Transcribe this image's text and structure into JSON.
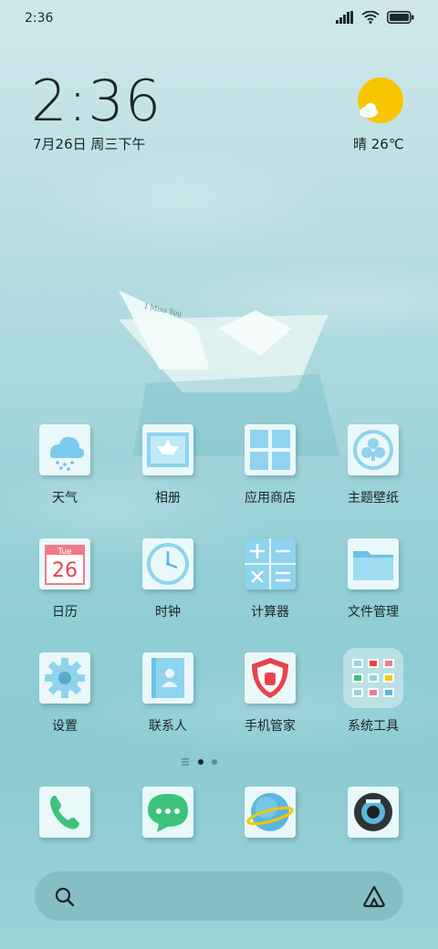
{
  "status_bar": {
    "time": "2:36",
    "icons": [
      "signal-icon",
      "wifi-icon",
      "battery-icon"
    ]
  },
  "clock_widget": {
    "time": "2:36",
    "date": "7月26日 周三下午"
  },
  "weather_widget": {
    "icon": "sunny-cloud-icon",
    "text": "晴 26℃"
  },
  "wallpaper": {
    "boat_text": "I Miss You"
  },
  "apps": [
    {
      "label": "天气",
      "icon": "weather-icon"
    },
    {
      "label": "相册",
      "icon": "gallery-icon"
    },
    {
      "label": "应用商店",
      "icon": "app-store-icon"
    },
    {
      "label": "主题壁纸",
      "icon": "themes-icon"
    },
    {
      "label": "日历",
      "icon": "calendar-icon",
      "calendar_day": "Tue",
      "calendar_date": "26"
    },
    {
      "label": "时钟",
      "icon": "clock-icon"
    },
    {
      "label": "计算器",
      "icon": "calculator-icon"
    },
    {
      "label": "文件管理",
      "icon": "folder-icon"
    },
    {
      "label": "设置",
      "icon": "settings-gear-icon"
    },
    {
      "label": "联系人",
      "icon": "contacts-icon"
    },
    {
      "label": "手机管家",
      "icon": "security-shield-icon"
    },
    {
      "label": "系统工具",
      "icon": "tools-folder-icon"
    }
  ],
  "page_indicator": {
    "pages": 2,
    "active": 1
  },
  "dock": [
    {
      "icon": "phone-icon"
    },
    {
      "icon": "messages-icon"
    },
    {
      "icon": "browser-icon"
    },
    {
      "icon": "camera-icon"
    }
  ],
  "search_bar": {
    "left_icon": "search-icon",
    "right_icon": "assistant-icon"
  },
  "colors": {
    "text": "#1b2527",
    "tile": "#eaf8fa",
    "accent_blue": "#8fd3ee",
    "accent_red": "#e8434b",
    "accent_green": "#3dc27c",
    "sun": "#f7c600"
  }
}
